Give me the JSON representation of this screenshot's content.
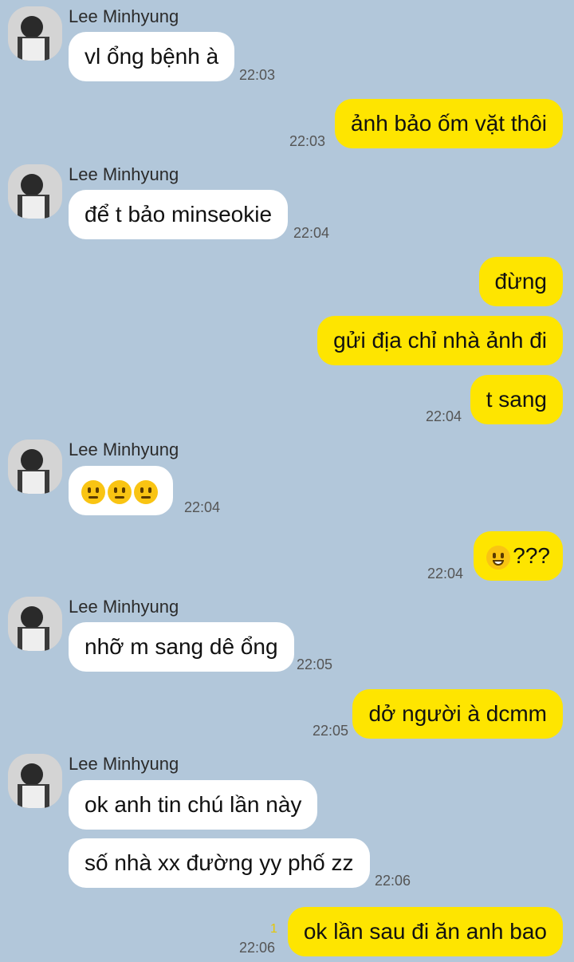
{
  "contact": {
    "name": "Lee Minhyung"
  },
  "messages": [
    {
      "text": "vl ổng bệnh à",
      "time": "22:03"
    },
    {
      "text": "ảnh bảo ốm vặt thôi",
      "time": "22:03"
    },
    {
      "text": "để t bảo minseokie",
      "time": "22:04"
    },
    {
      "text": "đừng"
    },
    {
      "text": "gửi địa chỉ nhà ảnh đi"
    },
    {
      "text": "t sang",
      "time": "22:04"
    },
    {
      "emojis": [
        "raised-eyebrow-face",
        "raised-eyebrow-face",
        "raised-eyebrow-face"
      ],
      "time": "22:04"
    },
    {
      "emoji": "grinning-face",
      "text": "???",
      "time": "22:04"
    },
    {
      "text": "nhỡ m sang dê ổng",
      "time": "22:05"
    },
    {
      "text": "dở người à dcmm",
      "time": "22:05"
    },
    {
      "text": "ok anh tin chú lần này"
    },
    {
      "text": "số nhà xx đường yy phố zz",
      "time": "22:06"
    },
    {
      "text": "ok lần sau đi ăn anh bao",
      "time": "22:06",
      "unread": "1"
    }
  ],
  "colors": {
    "background": "#b2c7da",
    "incoming": "#ffffff",
    "outgoing": "#fee500"
  }
}
